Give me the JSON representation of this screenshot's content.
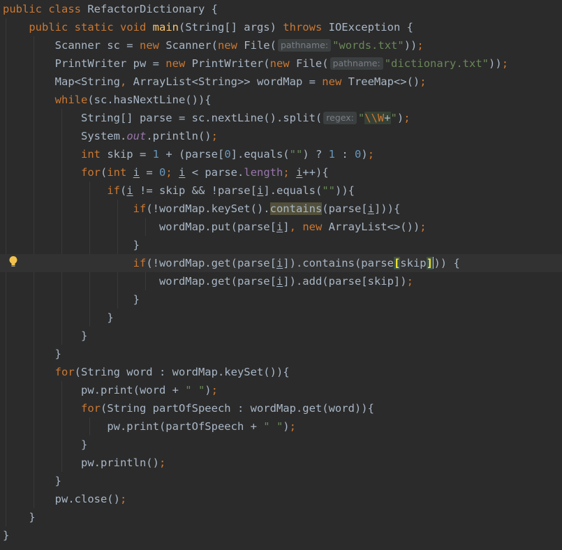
{
  "editor": {
    "indent_unit": "    ",
    "lines": [
      {
        "indent": 0,
        "tokens": [
          {
            "t": "public ",
            "c": "kw"
          },
          {
            "t": "class ",
            "c": "kw"
          },
          {
            "t": "RefactorDictionary {"
          }
        ]
      },
      {
        "indent": 1,
        "tokens": [
          {
            "t": "public ",
            "c": "kw"
          },
          {
            "t": "static ",
            "c": "kw"
          },
          {
            "t": "void ",
            "c": "kw"
          },
          {
            "t": "main",
            "c": "fn"
          },
          {
            "t": "(String[] args) "
          },
          {
            "t": "throws ",
            "c": "kw"
          },
          {
            "t": "IOException {"
          }
        ]
      },
      {
        "indent": 2,
        "tokens": [
          {
            "t": "Scanner sc = "
          },
          {
            "t": "new ",
            "c": "kw"
          },
          {
            "t": "Scanner("
          },
          {
            "t": "new ",
            "c": "kw"
          },
          {
            "t": "File("
          },
          {
            "t": "pathname:",
            "c": "hint"
          },
          {
            "t": "\"words.txt\"",
            "c": "str"
          },
          {
            "t": "))"
          },
          {
            "t": ";",
            "c": "kw"
          }
        ]
      },
      {
        "indent": 2,
        "tokens": [
          {
            "t": "PrintWriter pw = "
          },
          {
            "t": "new ",
            "c": "kw"
          },
          {
            "t": "PrintWriter("
          },
          {
            "t": "new ",
            "c": "kw"
          },
          {
            "t": "File("
          },
          {
            "t": "pathname:",
            "c": "hint"
          },
          {
            "t": "\"dictionary.txt\"",
            "c": "str"
          },
          {
            "t": "))"
          },
          {
            "t": ";",
            "c": "kw"
          }
        ]
      },
      {
        "indent": 2,
        "tokens": [
          {
            "t": "Map<String"
          },
          {
            "t": ", ",
            "c": "kw"
          },
          {
            "t": "ArrayList<String>> wordMap = "
          },
          {
            "t": "new ",
            "c": "kw"
          },
          {
            "t": "TreeMap<>()"
          },
          {
            "t": ";",
            "c": "kw"
          }
        ]
      },
      {
        "indent": 2,
        "tokens": [
          {
            "t": "while",
            "c": "kw"
          },
          {
            "t": "(sc.hasNextLine()){"
          }
        ]
      },
      {
        "indent": 3,
        "tokens": [
          {
            "t": "String[] parse = sc.nextLine().split("
          },
          {
            "t": "regex:",
            "c": "hint"
          },
          {
            "t": "\"",
            "c": "str"
          },
          {
            "t": "\\\\W",
            "c": "esc"
          },
          {
            "t": "+",
            "c": "regex"
          },
          {
            "t": "\"",
            "c": "str"
          },
          {
            "t": ")"
          },
          {
            "t": ";",
            "c": "kw"
          }
        ]
      },
      {
        "indent": 3,
        "tokens": [
          {
            "t": "System."
          },
          {
            "t": "out",
            "c": "st"
          },
          {
            "t": ".println()"
          },
          {
            "t": ";",
            "c": "kw"
          }
        ]
      },
      {
        "indent": 3,
        "tokens": [
          {
            "t": "int ",
            "c": "kw"
          },
          {
            "t": "skip = "
          },
          {
            "t": "1",
            "c": "num"
          },
          {
            "t": " + (parse["
          },
          {
            "t": "0",
            "c": "num"
          },
          {
            "t": "].equals("
          },
          {
            "t": "\"\"",
            "c": "str"
          },
          {
            "t": ") ? "
          },
          {
            "t": "1",
            "c": "num"
          },
          {
            "t": " : "
          },
          {
            "t": "0",
            "c": "num"
          },
          {
            "t": ")"
          },
          {
            "t": ";",
            "c": "kw"
          }
        ]
      },
      {
        "indent": 3,
        "tokens": [
          {
            "t": "for",
            "c": "kw"
          },
          {
            "t": "("
          },
          {
            "t": "int ",
            "c": "kw"
          },
          {
            "t": "i",
            "c": "und"
          },
          {
            "t": " = "
          },
          {
            "t": "0",
            "c": "num"
          },
          {
            "t": "; ",
            "c": "kw"
          },
          {
            "t": "i",
            "c": "und"
          },
          {
            "t": " < parse."
          },
          {
            "t": "length",
            "c": "fld"
          },
          {
            "t": "; ",
            "c": "kw"
          },
          {
            "t": "i",
            "c": "und"
          },
          {
            "t": "++){"
          }
        ]
      },
      {
        "indent": 4,
        "tokens": [
          {
            "t": "if",
            "c": "kw"
          },
          {
            "t": "("
          },
          {
            "t": "i",
            "c": "und"
          },
          {
            "t": " != skip && !parse["
          },
          {
            "t": "i",
            "c": "und"
          },
          {
            "t": "].equals("
          },
          {
            "t": "\"\"",
            "c": "str"
          },
          {
            "t": ")){"
          }
        ]
      },
      {
        "indent": 5,
        "tokens": [
          {
            "t": "if",
            "c": "kw"
          },
          {
            "t": "(!wordMap.keySet()."
          },
          {
            "t": "contains",
            "c": "usage"
          },
          {
            "t": "(parse["
          },
          {
            "t": "i",
            "c": "und"
          },
          {
            "t": "])){"
          }
        ]
      },
      {
        "indent": 6,
        "tokens": [
          {
            "t": "wordMap.put(parse["
          },
          {
            "t": "i",
            "c": "und"
          },
          {
            "t": "]"
          },
          {
            "t": ", ",
            "c": "kw"
          },
          {
            "t": "new ",
            "c": "kw"
          },
          {
            "t": "ArrayList<>())"
          },
          {
            "t": ";",
            "c": "kw"
          }
        ]
      },
      {
        "indent": 5,
        "tokens": [
          {
            "t": "}"
          }
        ]
      },
      {
        "indent": 5,
        "current": true,
        "tokens": [
          {
            "t": "if",
            "c": "kw"
          },
          {
            "t": "(!wordMap.get(parse["
          },
          {
            "t": "i",
            "c": "und"
          },
          {
            "t": "]).contains(parse"
          },
          {
            "t": "[",
            "c": "brace-match"
          },
          {
            "t": "skip"
          },
          {
            "t": "]",
            "c": "brace-match"
          },
          {
            "t": "",
            "c": "caret"
          },
          {
            "t": ")) {"
          }
        ]
      },
      {
        "indent": 6,
        "tokens": [
          {
            "t": "wordMap.get(parse["
          },
          {
            "t": "i",
            "c": "und"
          },
          {
            "t": "]).add(parse[skip])"
          },
          {
            "t": ";",
            "c": "kw"
          }
        ]
      },
      {
        "indent": 5,
        "tokens": [
          {
            "t": "}"
          }
        ]
      },
      {
        "indent": 4,
        "tokens": [
          {
            "t": "}"
          }
        ]
      },
      {
        "indent": 3,
        "tokens": [
          {
            "t": "}"
          }
        ]
      },
      {
        "indent": 2,
        "tokens": [
          {
            "t": "}"
          }
        ]
      },
      {
        "indent": 2,
        "tokens": [
          {
            "t": "for",
            "c": "kw"
          },
          {
            "t": "(String word : wordMap.keySet()){"
          }
        ]
      },
      {
        "indent": 3,
        "tokens": [
          {
            "t": "pw.print(word + "
          },
          {
            "t": "\" \"",
            "c": "str"
          },
          {
            "t": ")"
          },
          {
            "t": ";",
            "c": "kw"
          }
        ]
      },
      {
        "indent": 3,
        "tokens": [
          {
            "t": "for",
            "c": "kw"
          },
          {
            "t": "(String partOfSpeech : wordMap.get(word)){"
          }
        ]
      },
      {
        "indent": 4,
        "tokens": [
          {
            "t": "pw.print(partOfSpeech + "
          },
          {
            "t": "\" \"",
            "c": "str"
          },
          {
            "t": ")"
          },
          {
            "t": ";",
            "c": "kw"
          }
        ]
      },
      {
        "indent": 3,
        "tokens": [
          {
            "t": "}"
          }
        ]
      },
      {
        "indent": 3,
        "tokens": [
          {
            "t": "pw.println()"
          },
          {
            "t": ";",
            "c": "kw"
          }
        ]
      },
      {
        "indent": 2,
        "tokens": [
          {
            "t": "}"
          }
        ]
      },
      {
        "indent": 2,
        "tokens": [
          {
            "t": "pw.close()"
          },
          {
            "t": ";",
            "c": "kw"
          }
        ]
      },
      {
        "indent": 1,
        "tokens": [
          {
            "t": "}"
          }
        ]
      },
      {
        "indent": 0,
        "tokens": [
          {
            "t": "}"
          }
        ]
      }
    ],
    "gutter_icon": "lightbulb-icon",
    "colors": {
      "background": "#2b2b2b",
      "current_line": "#323232",
      "keyword": "#cc7832",
      "string": "#6a8759",
      "number": "#6897bb",
      "method": "#ffc66d",
      "field": "#9876aa",
      "text": "#a9b7c6",
      "bulb": "#f2c14e"
    }
  }
}
